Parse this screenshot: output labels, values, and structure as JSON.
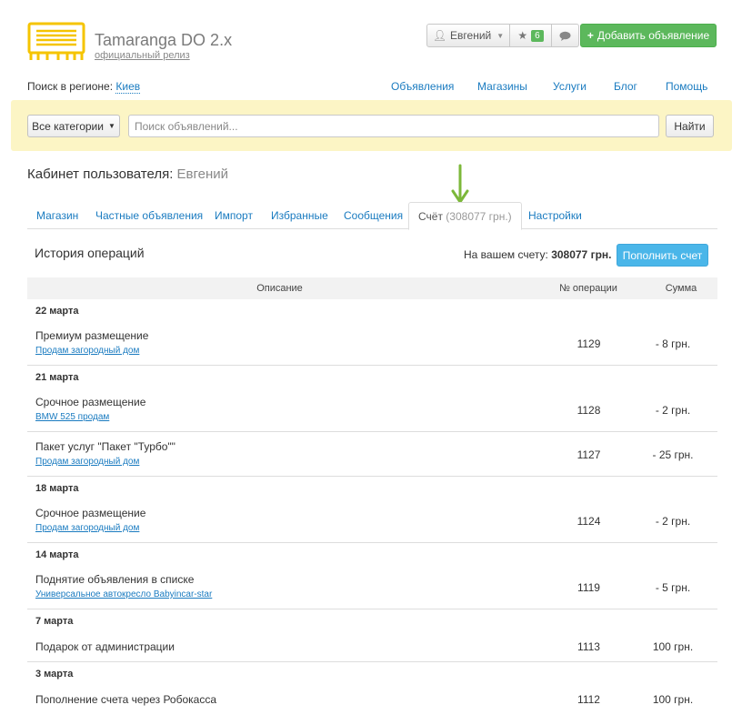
{
  "brand": {
    "name": "Tamaranga DO 2.x",
    "subtitle": "официальный релиз"
  },
  "user_menu": {
    "user_name": "Евгений",
    "favorites_count": "6",
    "add_button": "Добавить объявление"
  },
  "region": {
    "label": "Поиск в регионе:",
    "value": "Киев"
  },
  "topnav": [
    "Объявления",
    "Магазины",
    "Услуги",
    "Блог",
    "Помощь"
  ],
  "search": {
    "category": "Все категории",
    "placeholder": "Поиск объявлений...",
    "button": "Найти"
  },
  "cabinet": {
    "title": "Кабинет пользователя:",
    "user": "Евгений"
  },
  "tabs": [
    "Магазин",
    "Частные объявления",
    "Импорт",
    "Избранные",
    "Сообщения",
    "Счёт",
    "(308077 грн.)",
    "Настройки"
  ],
  "history": {
    "title": "История операций",
    "balance_label": "На вашем счету:",
    "balance_value": "308077 грн.",
    "topup_button": "Пополнить счет"
  },
  "table": {
    "headers": [
      "Описание",
      "№ операции",
      "Сумма"
    ],
    "groups": [
      {
        "date": "22 марта",
        "items": [
          {
            "desc": "Премиум размещение",
            "link": "Продам загородный дом",
            "num": "1129",
            "sum": "- 8 грн."
          }
        ]
      },
      {
        "date": "21 марта",
        "items": [
          {
            "desc": "Срочное размещение",
            "link": "BMW 525 продам",
            "num": "1128",
            "sum": "- 2 грн."
          },
          {
            "desc": "Пакет услуг \"Пакет \"Турбо\"\"",
            "link": "Продам загородный дом",
            "num": "1127",
            "sum": "- 25 грн."
          }
        ]
      },
      {
        "date": "18 марта",
        "items": [
          {
            "desc": "Срочное размещение",
            "link": "Продам загородный дом",
            "num": "1124",
            "sum": "- 2 грн."
          }
        ]
      },
      {
        "date": "14 марта",
        "items": [
          {
            "desc": "Поднятие объявления в списке",
            "link": "Универсальное автокресло Babyincar-star",
            "num": "1119",
            "sum": "- 5 грн."
          }
        ]
      },
      {
        "date": "7 марта",
        "items": [
          {
            "desc": "Подарок от администрации",
            "link": "",
            "num": "1113",
            "sum": "100 грн."
          }
        ]
      },
      {
        "date": "3 марта",
        "items": [
          {
            "desc": "Пополнение счета через Робокасса",
            "link": "",
            "num": "1112",
            "sum": "100 грн."
          }
        ]
      }
    ]
  },
  "colors": {
    "accent_green": "#5cb85c",
    "accent_blue": "#4ab6e9",
    "search_bg": "#fcf5c5",
    "link": "#1a7bc0",
    "arrow": "#7cb83a"
  }
}
